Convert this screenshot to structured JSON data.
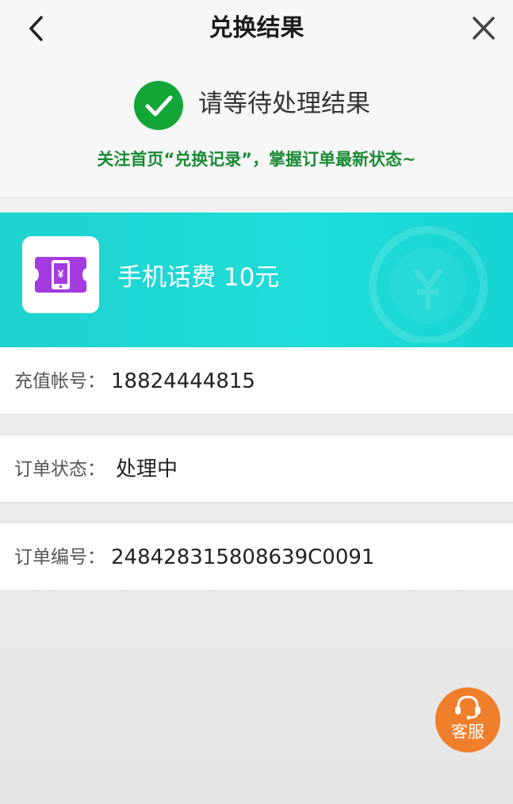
{
  "header": {
    "title": "兑换结果",
    "back_icon": "chevron-left-icon",
    "close_icon": "close-icon"
  },
  "status": {
    "icon": "check-circle-icon",
    "title": "请等待处理结果",
    "tip": "关注首页“兑换记录”，掌握订单最新状态~",
    "color": "#13a538"
  },
  "product": {
    "icon": "phone-recharge-icon",
    "name": "手机话费  10元",
    "card_color": "#1ed3d0"
  },
  "details": {
    "account_label": "充值帐号：",
    "account_value": "18824444815",
    "status_label": "订单状态：",
    "status_value": "处理中",
    "order_label": "订单编号：",
    "order_value": "248428315808639C0091"
  },
  "service": {
    "icon": "headset-icon",
    "label": "客服",
    "color": "#f07f2b"
  }
}
